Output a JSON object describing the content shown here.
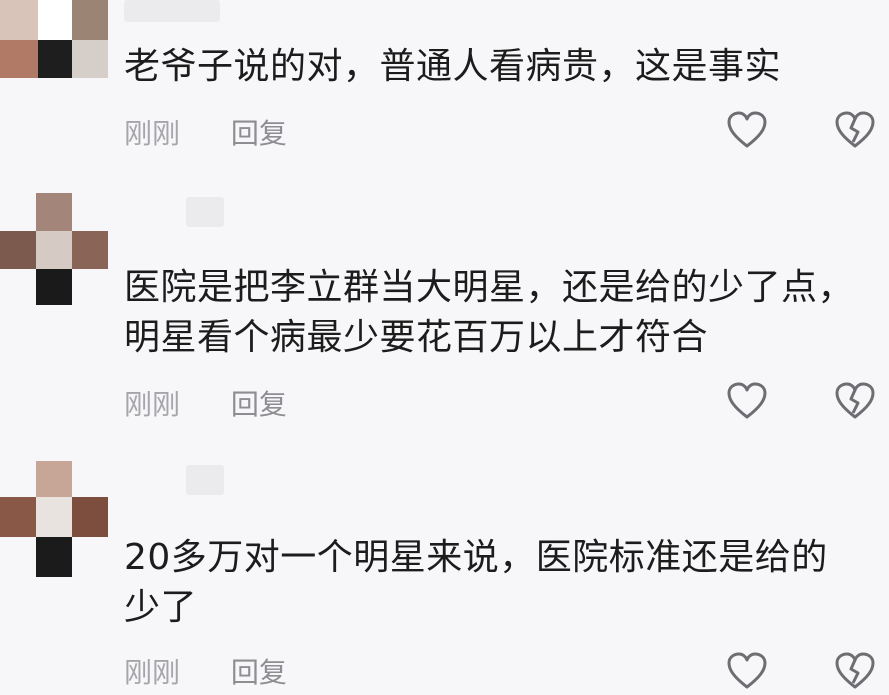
{
  "comments": [
    {
      "text": "老爷子说的对，普通人看病贵，这是事实",
      "time": "刚刚",
      "reply": "回复"
    },
    {
      "text": "医院是把李立群当大明星，还是给的少了点，明星看个病最少要花百万以上才符合",
      "time": "刚刚",
      "reply": "回复"
    },
    {
      "text": "20多万对一个明星来说，医院标准还是给的少了",
      "time": "刚刚",
      "reply": "回复"
    }
  ],
  "icons": {
    "like": "heart-icon",
    "dislike": "broken-heart-icon"
  },
  "colors": {
    "text": "#1c1c1c",
    "meta": "#8e8e92",
    "icon": "#6e6e72",
    "background": "#f7f7f9"
  }
}
